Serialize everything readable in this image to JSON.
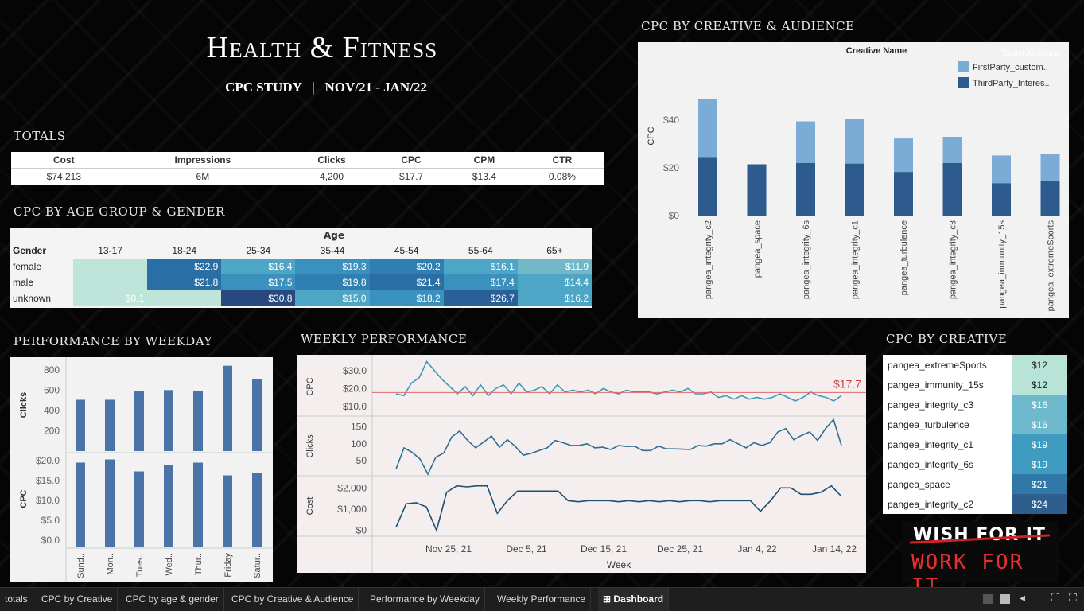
{
  "header": {
    "title": "Health & Fitness",
    "subtitle": "CPC STUDY   |   NOV/21 - JAN/22"
  },
  "sections": {
    "totals": "TOTALS",
    "age_gender": "CPC BY AGE GROUP & GENDER",
    "weekday": "PERFORMANCE BY WEEKDAY",
    "weekly": "WEEKLY PERFORMANCE",
    "creative_audience": "CPC BY CREATIVE & AUDIENCE",
    "creative": "CPC BY CREATIVE"
  },
  "totals": {
    "headers": [
      "Cost",
      "Impressions",
      "Clicks",
      "CPC",
      "CPM",
      "CTR"
    ],
    "values": [
      "$74,213",
      "6M",
      "4,200",
      "$17.7",
      "$13.4",
      "0.08%"
    ]
  },
  "age_gender": {
    "age_label": "Age",
    "gender_label": "Gender",
    "ages": [
      "13-17",
      "18-24",
      "25-34",
      "35-44",
      "45-54",
      "55-64",
      "65+"
    ],
    "rows": [
      {
        "gender": "female",
        "values": [
          "",
          "$22.9",
          "$16.4",
          "$19.3",
          "$20.2",
          "$16.1",
          "$11.9"
        ]
      },
      {
        "gender": "male",
        "values": [
          "",
          "$21.8",
          "$17.5",
          "$19.8",
          "$21.4",
          "$17.4",
          "$14.4"
        ]
      },
      {
        "gender": "unknown",
        "values": [
          "$0.1",
          "",
          "$30.8",
          "$15.0",
          "$18.2",
          "$26.7",
          "$16.2"
        ]
      }
    ]
  },
  "chart_data": [
    {
      "type": "bar",
      "title": "CPC by Creative & Audience",
      "column_header": "Creative Name",
      "legend_title": "Target Audience",
      "ylabel": "CPC",
      "ylim": [
        0,
        50
      ],
      "yticks": [
        "$0",
        "$20",
        "$40"
      ],
      "stacked": true,
      "categories": [
        "pangea_integrity_c2",
        "pangea_space",
        "pangea_integrity_6s",
        "pangea_integrity_c1",
        "pangea_turbulence",
        "pangea_integrity_c3",
        "pangea_immunity_15s",
        "pangea_extremeSports"
      ],
      "series": [
        {
          "name": "ThirdParty_Interes..",
          "color": "#2e5b8e",
          "values": [
            24.5,
            21.5,
            22,
            21.8,
            18.3,
            22,
            13.6,
            14.6
          ]
        },
        {
          "name": "FirstParty_custom..",
          "color": "#7bacd6",
          "values": [
            24.5,
            0,
            17.5,
            18.7,
            14,
            11,
            11.6,
            11.3
          ]
        }
      ]
    },
    {
      "type": "bar",
      "title": "Performance by Weekday - Clicks",
      "ylabel": "Clicks",
      "ylim": [
        0,
        900
      ],
      "yticks": [
        "200",
        "400",
        "600",
        "800"
      ],
      "categories": [
        "Sund..",
        "Mon..",
        "Tues..",
        "Wed..",
        "Thur..",
        "Friday",
        "Satur.."
      ],
      "values": [
        505,
        505,
        590,
        600,
        595,
        840,
        710
      ]
    },
    {
      "type": "bar",
      "title": "Performance by Weekday - CPC",
      "ylabel": "CPC",
      "ylim": [
        0,
        21
      ],
      "yticks": [
        "$0.0",
        "$5.0",
        "$10.0",
        "$15.0",
        "$20.0"
      ],
      "categories": [
        "Sund..",
        "Mon..",
        "Tues..",
        "Wed..",
        "Thur..",
        "Friday",
        "Satur.."
      ],
      "values": [
        19.5,
        20.3,
        17.3,
        18.8,
        19.5,
        16.3,
        16.8
      ]
    },
    {
      "type": "line",
      "title": "Weekly Performance",
      "xlabel": "Week",
      "xticks": [
        "Nov 25, 21",
        "Dec 5, 21",
        "Dec 15, 21",
        "Dec 25, 21",
        "Jan 4, 22",
        "Jan 14, 22"
      ],
      "reference_line": {
        "label": "$17.7",
        "value": 17.7
      },
      "series": [
        {
          "name": "CPC",
          "yticks": [
            "$10.0",
            "$20.0",
            "$30.0"
          ],
          "ylim": [
            5,
            37
          ],
          "values": [
            17,
            16,
            23,
            26,
            35,
            30,
            25,
            21,
            17,
            21,
            16,
            22,
            16,
            20,
            22,
            17,
            23,
            18,
            19,
            21,
            17,
            22,
            18,
            19,
            18,
            19,
            17,
            20,
            18,
            17,
            19,
            18,
            18,
            18,
            17,
            18,
            19,
            18,
            20,
            17,
            17,
            18,
            15,
            16,
            14,
            16,
            14,
            15,
            14,
            15,
            17,
            15,
            13,
            15,
            18,
            16,
            15,
            13,
            16
          ],
          "color": "#3d9bb8"
        },
        {
          "name": "Clicks",
          "yticks": [
            "50",
            "100",
            "150"
          ],
          "ylim": [
            10,
            175
          ],
          "values": [
            25,
            88,
            75,
            55,
            10,
            60,
            73,
            120,
            138,
            110,
            88,
            105,
            123,
            90,
            112,
            92,
            66,
            72,
            80,
            88,
            110,
            103,
            95,
            95,
            100,
            88,
            90,
            83,
            95,
            92,
            93,
            80,
            80,
            93,
            85,
            85,
            84,
            83,
            95,
            93,
            100,
            100,
            112,
            100,
            88,
            103,
            95,
            103,
            135,
            145,
            112,
            125,
            135,
            110,
            145,
            172,
            95
          ],
          "color": "#2d6e94"
        },
        {
          "name": "Cost",
          "yticks": [
            "$0",
            "$1,000",
            "$2,000"
          ],
          "ylim": [
            -200,
            2500
          ],
          "values": [
            150,
            1250,
            1300,
            1100,
            0,
            1800,
            2100,
            2050,
            2100,
            2100,
            800,
            1400,
            1850,
            1850,
            1850,
            1850,
            1850,
            1400,
            1350,
            1400,
            1400,
            1400,
            1350,
            1400,
            1350,
            1400,
            1350,
            1400,
            1350,
            1400,
            1400,
            1350,
            1400,
            1400,
            1400,
            1400,
            900,
            1400,
            2000,
            2000,
            1700,
            1700,
            1800,
            2100,
            1600
          ],
          "color": "#1d4f73"
        }
      ]
    }
  ],
  "cpc_by_creative": [
    {
      "name": "pangea_extremeSports",
      "value": "$12",
      "color": "#b8e3d7"
    },
    {
      "name": "pangea_immunity_15s",
      "value": "$12",
      "color": "#b8e3d7"
    },
    {
      "name": "pangea_integrity_c3",
      "value": "$16",
      "color": "#6cbacb"
    },
    {
      "name": "pangea_turbulence",
      "value": "$16",
      "color": "#6cbacb"
    },
    {
      "name": "pangea_integrity_c1",
      "value": "$19",
      "color": "#3f9bbf"
    },
    {
      "name": "pangea_integrity_6s",
      "value": "$19",
      "color": "#3f9bbf"
    },
    {
      "name": "pangea_space",
      "value": "$21",
      "color": "#2f78a8"
    },
    {
      "name": "pangea_integrity_c2",
      "value": "$24",
      "color": "#2d5e8e"
    }
  ],
  "badge": {
    "line1": "WISH FOR IT",
    "line2": "WORK FOR IT"
  },
  "tabs": [
    "totals",
    "CPC by Creative",
    "CPC by age & gender",
    "CPC by Creative & Audience",
    "Performance by Weekday",
    "Weekly Performance",
    "Dashboard"
  ],
  "active_tab": "Dashboard"
}
